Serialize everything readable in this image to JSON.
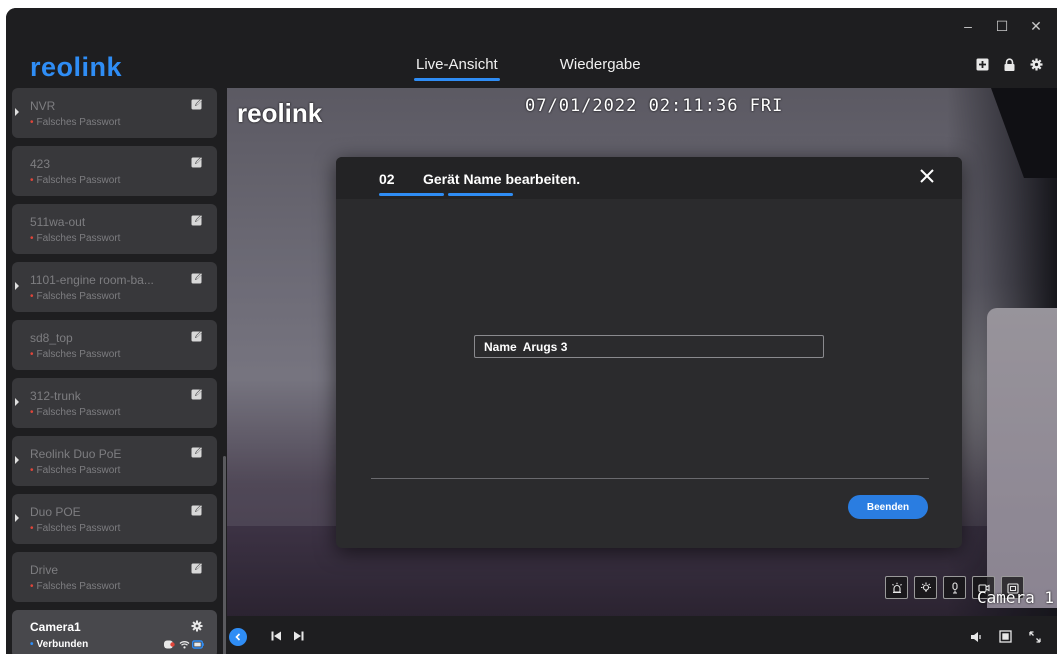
{
  "app": {
    "logo": "reolink",
    "window_controls": [
      "–",
      "☐",
      "✕"
    ]
  },
  "nav": {
    "tabs": [
      {
        "label": "Live-Ansicht",
        "active": true
      },
      {
        "label": "Wiedergabe",
        "active": false
      }
    ]
  },
  "header_icons": [
    "add-device-icon",
    "lock-icon",
    "settings-icon"
  ],
  "sidebar": {
    "devices": [
      {
        "name": "NVR",
        "status": "Falsches Passwort",
        "expandable": true
      },
      {
        "name": "423",
        "status": "Falsches Passwort",
        "expandable": false
      },
      {
        "name": "511wa-out",
        "status": "Falsches Passwort",
        "expandable": false
      },
      {
        "name": "1101-engine room-ba...",
        "status": "Falsches Passwort",
        "expandable": true
      },
      {
        "name": "sd8_top",
        "status": "Falsches Passwort",
        "expandable": false
      },
      {
        "name": "312-trunk",
        "status": "Falsches Passwort",
        "expandable": true
      },
      {
        "name": "Reolink Duo PoE",
        "status": "Falsches Passwort",
        "expandable": true
      },
      {
        "name": "Duo POE",
        "status": "Falsches Passwort",
        "expandable": true
      },
      {
        "name": "Drive",
        "status": "Falsches Passwort",
        "expandable": false
      }
    ],
    "selected": {
      "name": "Camera1",
      "status": "Verbunden"
    }
  },
  "video": {
    "overlay_logo": "reolink",
    "timestamp": "07/01/2022 02:11:36 FRI",
    "camera_label": "Camera 1",
    "controls": [
      "siren-icon",
      "spotlight-icon",
      "microphone-icon",
      "record-icon",
      "snapshot-icon"
    ]
  },
  "dialog": {
    "step": "02",
    "title": "Gerät Name bearbeiten.",
    "name_label": "Name",
    "name_value": "Arugs 3",
    "finish_label": "Beenden"
  },
  "bottom_bar": {
    "controls": [
      "collapse-icon",
      "previous-icon",
      "next-icon",
      "volume-icon",
      "fullscreen-window-icon",
      "expand-icon"
    ]
  },
  "colors": {
    "accent": "#2f8df5",
    "error": "#e0453a",
    "background": "#1e1e20",
    "card": "#38383b"
  }
}
